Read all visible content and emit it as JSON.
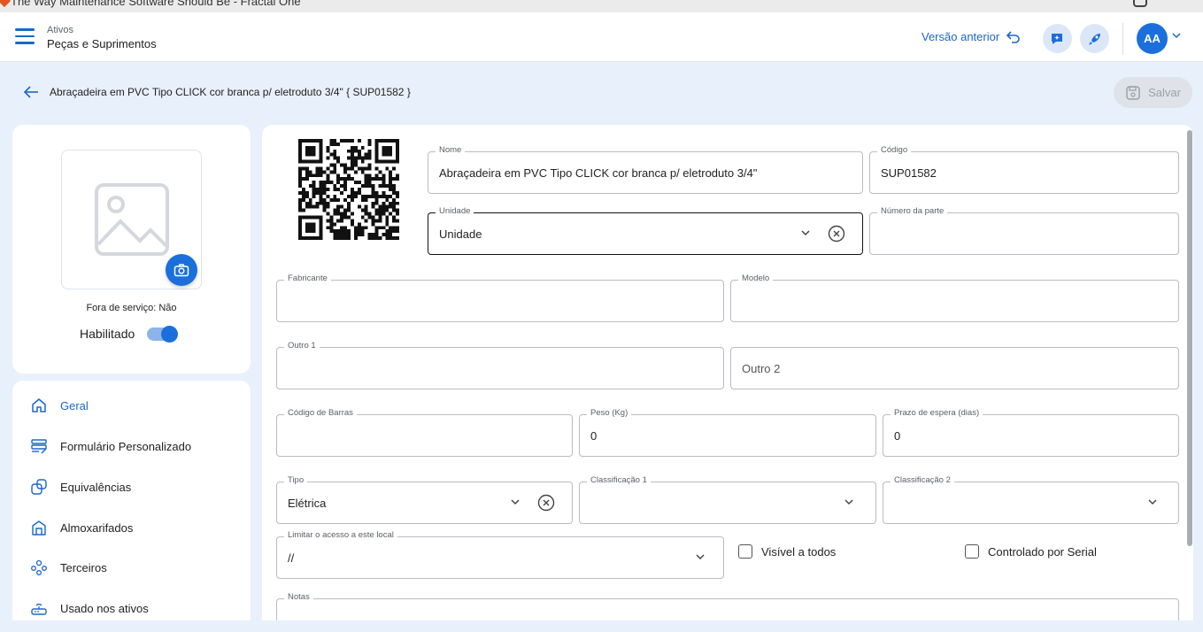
{
  "window": {
    "title": "The Way Maintenance Software Should Be - Fractal One"
  },
  "header": {
    "breadcrumb": "Ativos",
    "title": "Peças e Suprimentos",
    "previous_version": "Versão anterior",
    "avatar_initials": "AA"
  },
  "page": {
    "title": "Abraçadeira em PVC Tipo CLICK cor branca p/ eletroduto 3/4\" { SUP01582 }",
    "save_label": "Salvar"
  },
  "photo_card": {
    "out_of_service": "Fora de serviço: Não",
    "enabled_label": "Habilitado",
    "enabled": true
  },
  "nav": {
    "items": [
      {
        "label": "Geral",
        "icon": "home-icon",
        "active": true
      },
      {
        "label": "Formulário Personalizado",
        "icon": "form-icon",
        "active": false
      },
      {
        "label": "Equivalências",
        "icon": "equivalence-icon",
        "active": false
      },
      {
        "label": "Almoxarifados",
        "icon": "warehouse-icon",
        "active": false
      },
      {
        "label": "Terceiros",
        "icon": "people-icon",
        "active": false
      },
      {
        "label": "Usado nos ativos",
        "icon": "router-icon",
        "active": false
      }
    ]
  },
  "form": {
    "nome": {
      "label": "Nome",
      "value": "Abraçadeira em PVC Tipo CLICK cor branca p/ eletroduto 3/4\""
    },
    "codigo": {
      "label": "Código",
      "value": "SUP01582"
    },
    "unidade": {
      "label": "Unidade",
      "value": "Unidade"
    },
    "numero_parte": {
      "label": "Número da parte",
      "value": ""
    },
    "fabricante": {
      "label": "Fabricante",
      "value": ""
    },
    "modelo": {
      "label": "Modelo",
      "value": ""
    },
    "outro1": {
      "label": "Outro 1",
      "value": ""
    },
    "outro2": {
      "placeholder": "Outro 2",
      "value": ""
    },
    "codigo_barras": {
      "label": "Código de Barras",
      "value": ""
    },
    "peso": {
      "label": "Peso (Kg)",
      "value": "0"
    },
    "prazo": {
      "label": "Prazo de espera (dias)",
      "value": "0"
    },
    "tipo": {
      "label": "Tipo",
      "value": "Elétrica"
    },
    "classificacao1": {
      "label": "Classificação 1",
      "value": ""
    },
    "classificacao2": {
      "label": "Classificação 2",
      "value": ""
    },
    "limitar": {
      "label": "Limitar o acesso a este local",
      "value": "//"
    },
    "visivel": {
      "label": "Visível a todos",
      "checked": false
    },
    "serial": {
      "label": "Controlado por Serial",
      "checked": false
    },
    "notas": {
      "label": "Notas",
      "value": ""
    }
  },
  "colors": {
    "accent": "#1b6fdd",
    "background": "#e8f0fb"
  }
}
